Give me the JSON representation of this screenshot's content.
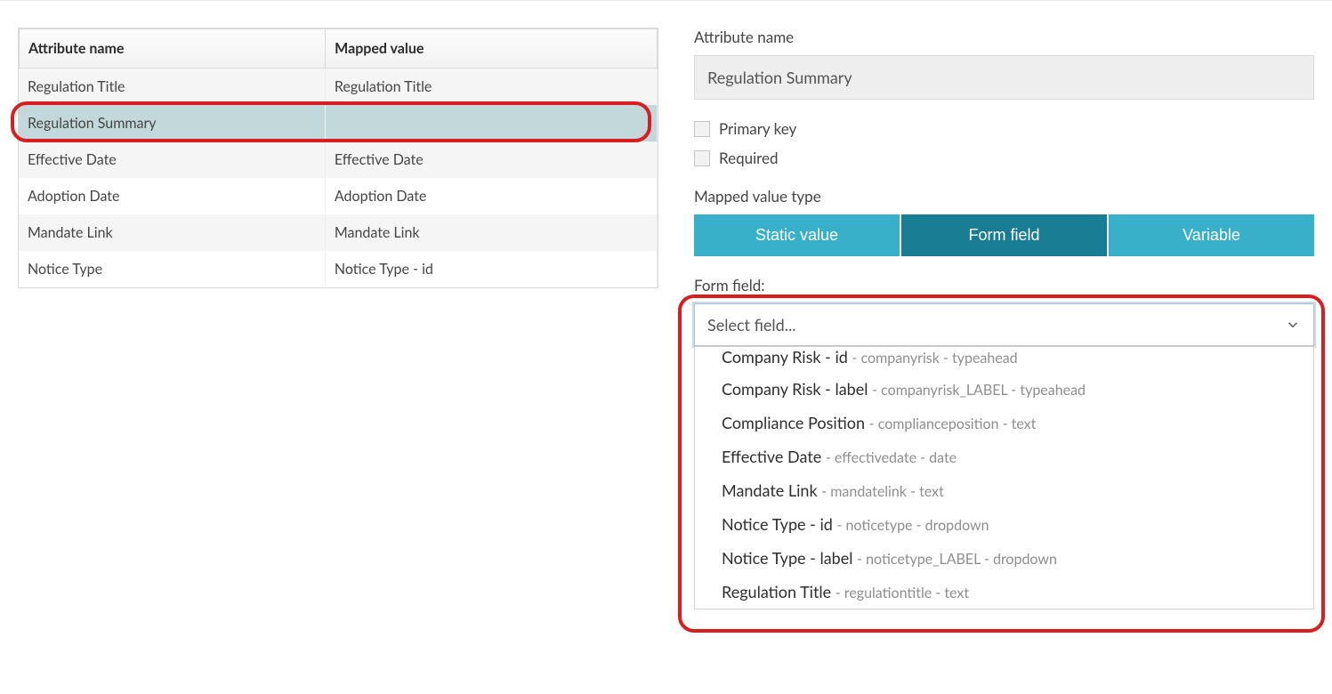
{
  "colors": {
    "accent": "#38b0c9",
    "accent_active": "#197e93",
    "annotation": "#d81e1e"
  },
  "table": {
    "headers": {
      "attr": "Attribute name",
      "mapped": "Mapped value"
    },
    "rows": [
      {
        "attr": "Regulation Title",
        "mapped": "Regulation Title",
        "selected": false
      },
      {
        "attr": "Regulation Summary",
        "mapped": "",
        "selected": true
      },
      {
        "attr": "Effective Date",
        "mapped": "Effective Date",
        "selected": false
      },
      {
        "attr": "Adoption Date",
        "mapped": "Adoption Date",
        "selected": false
      },
      {
        "attr": "Mandate Link",
        "mapped": "Mandate Link",
        "selected": false
      },
      {
        "attr": "Notice Type",
        "mapped": "Notice Type - id",
        "selected": false
      }
    ]
  },
  "form": {
    "attr_name_label": "Attribute name",
    "attr_name_value": "Regulation Summary",
    "primary_key_label": "Primary key",
    "primary_key_checked": false,
    "required_label": "Required",
    "required_checked": false,
    "mapped_value_type_label": "Mapped value type",
    "value_type_options": {
      "static": "Static value",
      "formfield": "Form field",
      "variable": "Variable"
    },
    "value_type_selected": "formfield",
    "form_field_label": "Form field:",
    "form_field_placeholder": "Select field...",
    "dropdown_options": [
      {
        "label": "Company Risk - id",
        "meta": "companyrisk - typeahead",
        "clipped": true
      },
      {
        "label": "Company Risk - label",
        "meta": "companyrisk_LABEL - typeahead",
        "clipped": false
      },
      {
        "label": "Compliance Position",
        "meta": "complianceposition - text",
        "clipped": false
      },
      {
        "label": "Effective Date",
        "meta": "effectivedate - date",
        "clipped": false
      },
      {
        "label": "Mandate Link",
        "meta": "mandatelink - text",
        "clipped": false
      },
      {
        "label": "Notice Type - id",
        "meta": "noticetype - dropdown",
        "clipped": false
      },
      {
        "label": "Notice Type - label",
        "meta": "noticetype_LABEL - dropdown",
        "clipped": false
      },
      {
        "label": "Regulation Title",
        "meta": "regulationtitle - text",
        "clipped": false
      }
    ]
  }
}
